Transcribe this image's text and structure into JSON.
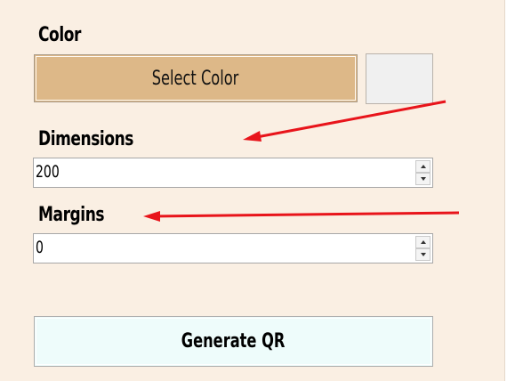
{
  "color_section": {
    "label": "Color",
    "select_button_label": "Select Color",
    "button_color": "#ddb888",
    "preview_color": "#f0f0f0"
  },
  "dimensions_section": {
    "label": "Dimensions",
    "value": "200"
  },
  "margins_section": {
    "label": "Margins",
    "value": "0"
  },
  "generate_button": {
    "label": "Generate QR",
    "color": "#eefcfb"
  },
  "annotations": {
    "arrow_color": "#e8141b"
  }
}
